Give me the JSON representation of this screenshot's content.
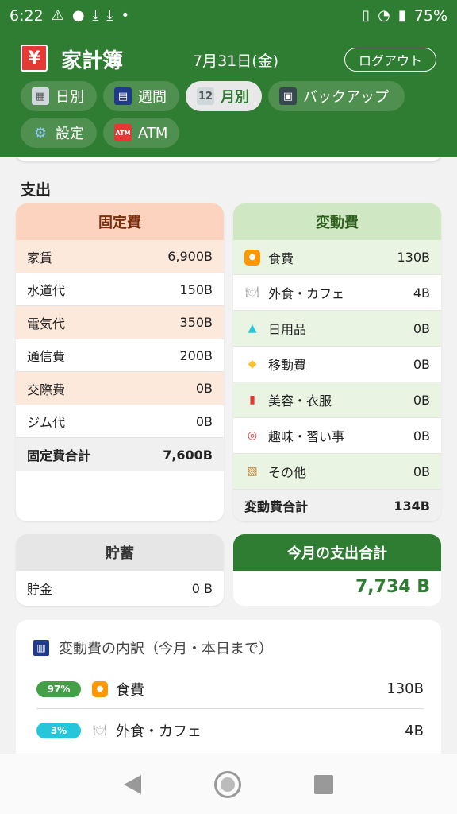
{
  "status": {
    "time": "6:22",
    "battery": "75%"
  },
  "header": {
    "logo": "¥",
    "title": "家計簿",
    "date": "7月31日(金)",
    "logout": "ログアウト"
  },
  "tabs": [
    {
      "label": "日別",
      "icon": "calendar-day-icon"
    },
    {
      "label": "週間",
      "icon": "calendar-week-icon"
    },
    {
      "label": "月別",
      "icon": "calendar-month-icon",
      "active": true
    },
    {
      "label": "バックアップ",
      "icon": "floppy-disk-icon"
    },
    {
      "label": "設定",
      "icon": "gear-icon"
    },
    {
      "label": "ATM",
      "icon": "atm-icon"
    }
  ],
  "section_title": "支出",
  "fixed": {
    "title": "固定費",
    "rows": [
      {
        "label": "家賃",
        "value": "6,900B"
      },
      {
        "label": "水道代",
        "value": "150B"
      },
      {
        "label": "電気代",
        "value": "350B"
      },
      {
        "label": "通信費",
        "value": "200B"
      },
      {
        "label": "交際費",
        "value": "0B"
      },
      {
        "label": "ジム代",
        "value": "0B"
      }
    ],
    "total_label": "固定費合計",
    "total_value": "7,600B"
  },
  "variable": {
    "title": "変動費",
    "rows": [
      {
        "label": "食費",
        "value": "130B",
        "icon": "food-icon"
      },
      {
        "label": "外食・カフェ",
        "value": "4B",
        "icon": "dining-icon"
      },
      {
        "label": "日用品",
        "value": "0B",
        "icon": "soap-icon"
      },
      {
        "label": "移動費",
        "value": "0B",
        "icon": "scooter-icon"
      },
      {
        "label": "美容・衣服",
        "value": "0B",
        "icon": "lipstick-icon"
      },
      {
        "label": "趣味・習い事",
        "value": "0B",
        "icon": "target-icon"
      },
      {
        "label": "その他",
        "value": "0B",
        "icon": "box-icon"
      }
    ],
    "total_label": "変動費合計",
    "total_value": "134B"
  },
  "savings": {
    "title": "貯蓄",
    "label": "貯金",
    "value": "0 B"
  },
  "monthly_total": {
    "title": "今月の支出合計",
    "value": "7,734 B"
  },
  "breakdown": {
    "title": "変動費の内訳（今月・本日まで）",
    "rows": [
      {
        "percent": "97%",
        "label": "食費",
        "value": "130B",
        "color": "#43a047"
      },
      {
        "percent": "3%",
        "label": "外食・カフェ",
        "value": "4B",
        "color": "#26c6da"
      }
    ]
  },
  "colors": {
    "primary": "#2e7d32",
    "fixed_header": "#fbd3bf",
    "fixed_alt": "#fde8dc",
    "variable_header": "#cfe8c3",
    "variable_alt": "#e9f4e3",
    "savings_header": "#e6e6e6"
  }
}
